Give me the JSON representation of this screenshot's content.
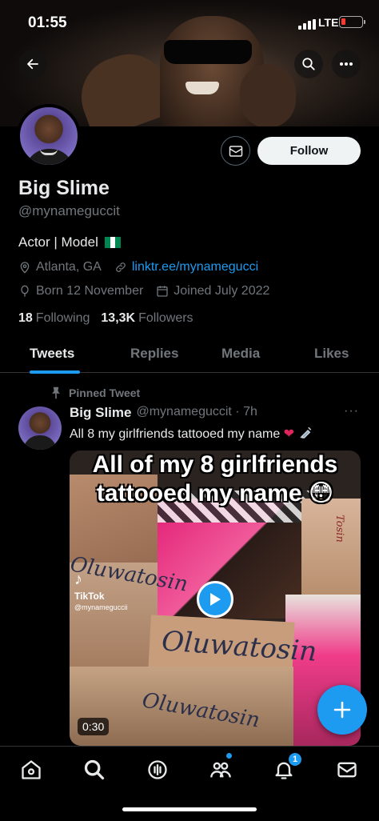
{
  "status_bar": {
    "time": "01:55",
    "network": "LTE"
  },
  "profile": {
    "name": "Big Slime",
    "handle": "@mynameguccit",
    "bio": "Actor | Model",
    "location": "Atlanta, GA",
    "link": "linktr.ee/mynamegucci",
    "born": "Born 12 November",
    "joined": "Joined July 2022",
    "following_count": "18",
    "following_label": "Following",
    "followers_count": "13,3K",
    "followers_label": "Followers",
    "follow_label": "Follow"
  },
  "tabs": [
    "Tweets",
    "Replies",
    "Media",
    "Likes"
  ],
  "tweet": {
    "pinned_label": "Pinned Tweet",
    "author": "Big Slime",
    "handle_time": "@mynameguccit · 7h",
    "text": "All 8 my girlfriends tattooed my name",
    "media_caption_line1": "All of my 8 girlfriends",
    "media_caption_line2": "tattooed my name 😳",
    "tiktok_label": "TikTok",
    "tiktok_handle": "@mynameguccii",
    "duration": "0:30"
  },
  "bottom_nav": {
    "notifications_badge": "1"
  },
  "colors": {
    "accent": "#1d9bf0",
    "background": "#000000",
    "follow_button": "#eff3f4",
    "flag_green": "#008751"
  }
}
